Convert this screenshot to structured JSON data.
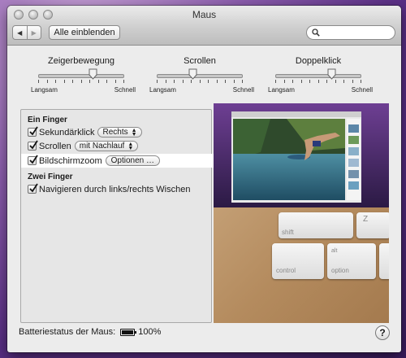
{
  "window": {
    "title": "Maus"
  },
  "toolbar": {
    "back_glyph": "◀",
    "forward_glyph": "▶",
    "show_all_label": "Alle einblenden",
    "search_value": ""
  },
  "sliders": [
    {
      "title": "Zeigerbewegung",
      "min_label": "Langsam",
      "max_label": "Schnell",
      "level": 0.65
    },
    {
      "title": "Scrollen",
      "min_label": "Langsam",
      "max_label": "Schnell",
      "level": 0.43
    },
    {
      "title": "Doppelklick",
      "min_label": "Langsam",
      "max_label": "Schnell",
      "level": 0.67
    }
  ],
  "gestures": {
    "one_finger_heading": "Ein Finger",
    "secondary_click": {
      "label": "Sekundärklick",
      "checked": true,
      "option": "Rechts"
    },
    "scrolling": {
      "label": "Scrollen",
      "checked": true,
      "option": "mit Nachlauf"
    },
    "screen_zoom": {
      "label": "Bildschirmzoom",
      "checked": true,
      "button": "Optionen …"
    },
    "two_finger_heading": "Zwei Finger",
    "swipe_navigate": {
      "label": "Navigieren durch links/rechts Wischen",
      "checked": true
    }
  },
  "preview_keys": {
    "shift": "shift",
    "z": "Z",
    "control": "control",
    "alt": "alt",
    "option": "option"
  },
  "footer": {
    "battery_label": "Batteriestatus der Maus:",
    "battery_percent": "100%",
    "help_glyph": "?"
  },
  "colors": {
    "desktop": "#5a2f86",
    "window_bg": "#ececec",
    "selection": "#ffffff"
  }
}
